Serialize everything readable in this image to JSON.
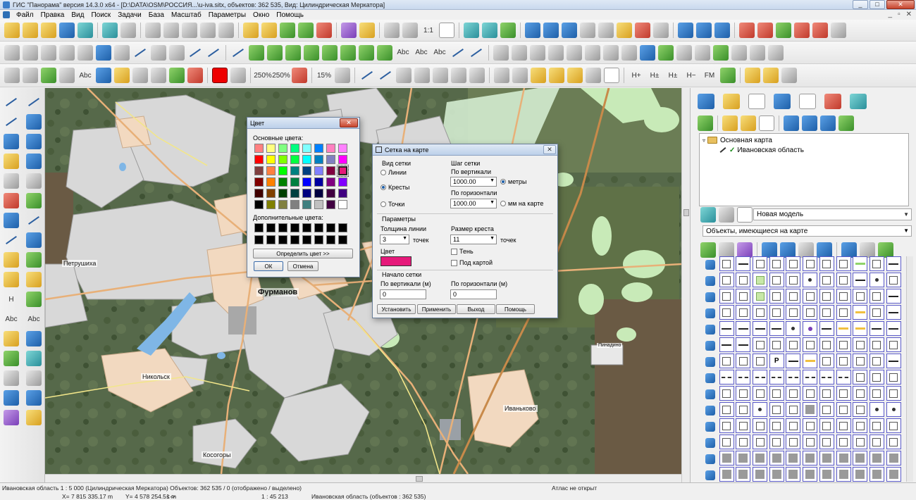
{
  "window": {
    "title": "ГИС \"Панорама\" версия 14.3.0 x64 - [D:\\DATA\\OSM\\РОССИЯ...\\u-iva.sitx, объектов: 362 535, Вид: Цилиндрическая Меркатора]"
  },
  "menu": {
    "items": [
      "Файл",
      "Правка",
      "Вид",
      "Поиск",
      "Задачи",
      "База",
      "Масштаб",
      "Параметры",
      "Окно",
      "Помощь"
    ]
  },
  "toolbar3": {
    "zoom_a": "250%",
    "zoom_b": "250%",
    "zoom_c": "15%"
  },
  "toolbar1": {
    "scale_label": "1:1"
  },
  "map": {
    "labels": {
      "petrushikha": "Петрушиха",
      "furmanov": "Фурманов",
      "nikolsk": "Никольск",
      "kosogory": "Косогоры",
      "ivankovo": "Иваньково",
      "small_label": "Пинадино"
    }
  },
  "color_dialog": {
    "title": "Цвет",
    "basic_label": "Основные цвета:",
    "custom_label": "Дополнительные цвета:",
    "define_button": "Определить цвет >>",
    "ok_button": "ОК",
    "cancel_button": "Отмена",
    "basic_colors": [
      "#ff8080",
      "#ffff80",
      "#80ff80",
      "#00ff80",
      "#80ffff",
      "#0080ff",
      "#ff80c0",
      "#ff80ff",
      "#ff0000",
      "#ffff00",
      "#80ff00",
      "#00ff40",
      "#00ffff",
      "#0080c0",
      "#8080c0",
      "#ff00ff",
      "#804040",
      "#ff8040",
      "#00ff00",
      "#008080",
      "#004080",
      "#8080ff",
      "#800040",
      "#e6197a",
      "#800000",
      "#ff8000",
      "#008000",
      "#008040",
      "#0000ff",
      "#0000a0",
      "#800080",
      "#8000ff",
      "#400000",
      "#804000",
      "#004000",
      "#004040",
      "#000080",
      "#000040",
      "#400040",
      "#400080",
      "#000000",
      "#808000",
      "#808040",
      "#808080",
      "#408080",
      "#c0c0c0",
      "#400040",
      "#ffffff"
    ],
    "selected_index": 23,
    "custom_colors": [
      "#000000",
      "#000000",
      "#000000",
      "#000000",
      "#000000",
      "#000000",
      "#000000",
      "#000000",
      "#000000",
      "#000000",
      "#000000",
      "#000000",
      "#000000",
      "#000000",
      "#000000",
      "#000000"
    ]
  },
  "grid_dialog": {
    "title": "Сетка на карте",
    "view_group": "Вид сетки",
    "view_lines": "Линии",
    "view_crosses": "Кресты",
    "view_points": "Точки",
    "step_group": "Шаг сетки",
    "step_vertical": "По вертикали",
    "step_vertical_value": "1000.00",
    "unit_meters": "метры",
    "step_horizontal": "По горизонтали",
    "step_horizontal_value": "1000.00",
    "unit_mm": "мм на карте",
    "params_group": "Параметры",
    "line_width_label": "Толщина линии",
    "line_width_value": "3",
    "line_width_unit": "точек",
    "cross_size_label": "Размер креста",
    "cross_size_value": "11",
    "cross_size_unit": "точек",
    "color_label": "Цвет",
    "color_value": "#e6197a",
    "shadow_label": "Тень",
    "under_map_label": "Под картой",
    "origin_group": "Начало сетки",
    "origin_vertical": "По вертикали (м)",
    "origin_vertical_value": "0",
    "origin_horizontal": "По горизонтали (м)",
    "origin_horizontal_value": "0",
    "btn_set": "Установить",
    "btn_apply": "Применить",
    "btn_exit": "Выход",
    "btn_help": "Помощь"
  },
  "right_panel": {
    "tree_root": "Основная карта",
    "tree_child": "Ивановская область",
    "model_select": "Новая модель",
    "objects_select": "Объекты, имеющиеся на карте"
  },
  "status": {
    "region_info": "Ивановская область  1 : 5 000 (Цилиндрическая Меркатора) Объектов: 362 535 / 0 (отображено / выделено)",
    "atlas": "Атлас не открыт",
    "x_coord": "X= 7 815 335.17 m",
    "y_coord": "Y= 4 578 254.51 m",
    "arrows": "<->",
    "scale": "1 : 45 213",
    "region_objects": "Ивановская область  (объектов : 362 535)"
  }
}
